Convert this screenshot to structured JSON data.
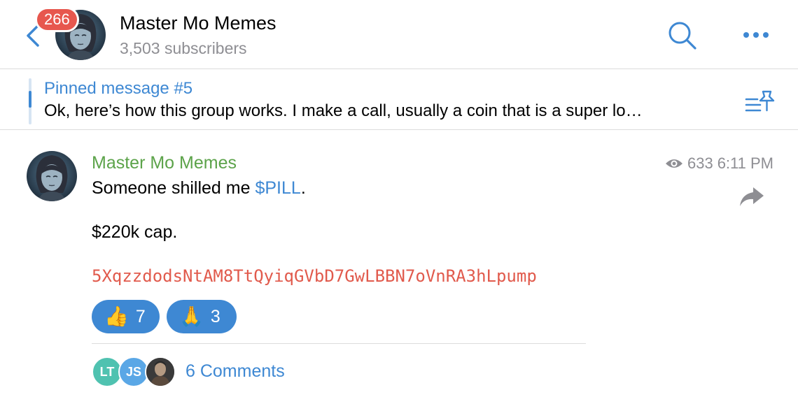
{
  "header": {
    "unread_badge": "266",
    "channel_name": "Master Mo Memes",
    "subscribers": "3,503 subscribers"
  },
  "pinned": {
    "title": "Pinned message #5",
    "preview": "Ok, here’s how this group works.  I make a call, usually a coin that is a super lo…"
  },
  "message": {
    "sender": "Master Mo Memes",
    "views": "633",
    "time": "6:11 PM",
    "line1_prefix": "Someone shilled me ",
    "line1_link": "$PILL",
    "line1_suffix": ".",
    "line2": "$220k cap.",
    "contract_address": "5XqzzdodsNtAM8TtQyiqGVbD7GwLBBN7oVnRA3hLpump",
    "reactions": [
      {
        "emoji": "👍",
        "count": "7"
      },
      {
        "emoji": "🙏",
        "count": "3"
      }
    ],
    "comments": {
      "avatars": [
        {
          "initials": "LT",
          "color": "#4fc2b0"
        },
        {
          "initials": "JS",
          "color": "#5aa7e6"
        },
        {
          "initials": "",
          "color": "#333333"
        }
      ],
      "label": "6 Comments"
    }
  },
  "colors": {
    "accent": "#3e88d3",
    "sender_green": "#5ca34a",
    "address_red": "#e15a4c",
    "badge_red": "#e7574e",
    "muted": "#8e8e93"
  },
  "icons": [
    "back-chevron-icon",
    "search-icon",
    "more-icon",
    "pinned-list-icon",
    "eye-icon",
    "forward-icon"
  ]
}
